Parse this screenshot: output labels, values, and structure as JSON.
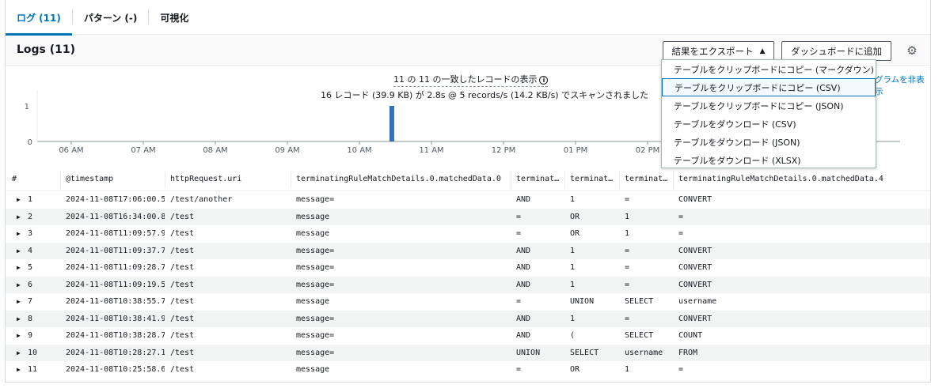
{
  "tabs": [
    {
      "label": "ログ (11)",
      "active": true
    },
    {
      "label": "パターン (-)",
      "active": false
    },
    {
      "label": "可視化",
      "active": false
    }
  ],
  "header": {
    "title": "Logs (11)",
    "export_label": "結果をエクスポート",
    "dashboard_label": "ダッシュボードに追加",
    "gear_icon": "gear-icon"
  },
  "summary": {
    "matched": "11 の 11 の一致したレコードの表示",
    "scanned": "16 レコード (39.9 KB) が 2.8s @ 5 records/s (14.2 KB/s) でスキャンされました",
    "hide_histogram": "グラムを非表示"
  },
  "chart_data": {
    "type": "bar",
    "x": [
      "06 AM",
      "07 AM",
      "08 AM",
      "09 AM",
      "10 AM",
      "11 AM",
      "12 PM",
      "01 PM",
      "02 PM"
    ],
    "ylim": [
      0,
      1
    ],
    "yticks": [
      "0",
      "1"
    ],
    "bars": [
      {
        "x_hours": 10.45,
        "value": 1
      }
    ],
    "color": "#2e73b8"
  },
  "export_menu": [
    "テーブルをクリップボードにコピー (マークダウン)",
    "テーブルをクリップボードにコピー (CSV)",
    "テーブルをクリップボードにコピー (JSON)",
    "テーブルをダウンロード (CSV)",
    "テーブルをダウンロード (JSON)",
    "テーブルをダウンロード (XLSX)"
  ],
  "export_menu_highlighted": 1,
  "table": {
    "columns": [
      "#",
      "@timestamp",
      "httpRequest.uri",
      "terminatingRuleMatchDetails.0.matchedData.0",
      "terminat…",
      "terminat…",
      "terminat…",
      "terminatingRuleMatchDetails.0.matchedData.4"
    ],
    "rows": [
      [
        "1",
        "2024-11-08T17:06:00.5…",
        "/test/another",
        "message=",
        "AND",
        "1",
        "=",
        "CONVERT"
      ],
      [
        "2",
        "2024-11-08T16:34:00.8…",
        "/test",
        "message",
        "=",
        "OR",
        "1",
        "="
      ],
      [
        "3",
        "2024-11-08T11:09:57.9…",
        "/test",
        "message",
        "=",
        "OR",
        "1",
        "="
      ],
      [
        "4",
        "2024-11-08T11:09:37.7…",
        "/test",
        "message=",
        "AND",
        "1",
        "=",
        "CONVERT"
      ],
      [
        "5",
        "2024-11-08T11:09:28.7…",
        "/test",
        "message=",
        "AND",
        "1",
        "=",
        "CONVERT"
      ],
      [
        "6",
        "2024-11-08T11:09:19.5…",
        "/test",
        "message=",
        "AND",
        "1",
        "=",
        "CONVERT"
      ],
      [
        "7",
        "2024-11-08T10:38:55.7…",
        "/test",
        "message",
        "=",
        "UNION",
        "SELECT",
        "username"
      ],
      [
        "8",
        "2024-11-08T10:38:41.9…",
        "/test",
        "message=",
        "AND",
        "1",
        "=",
        "CONVERT"
      ],
      [
        "9",
        "2024-11-08T10:38:28.7…",
        "/test",
        "message=",
        "AND",
        "(",
        "SELECT",
        "COUNT"
      ],
      [
        "10",
        "2024-11-08T10:28:27.1…",
        "/test",
        "message=",
        "UNION",
        "SELECT",
        "username",
        "FROM"
      ],
      [
        "11",
        "2024-11-08T10:25:58.6…",
        "/test",
        "message",
        "=",
        "OR",
        "1",
        "="
      ]
    ]
  }
}
